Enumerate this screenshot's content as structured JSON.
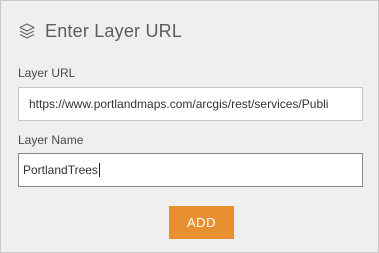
{
  "header": {
    "icon": "layers-icon",
    "title": "Enter Layer URL"
  },
  "layer_url": {
    "label": "Layer URL",
    "value": "https://www.portlandmaps.com/arcgis/rest/services/Publi"
  },
  "layer_name": {
    "label": "Layer Name",
    "value": "PortlandTrees"
  },
  "actions": {
    "add_label": "ADD"
  },
  "colors": {
    "panel_background": "#efefef",
    "accent_button": "#e8902f",
    "button_text": "#ffffff"
  }
}
